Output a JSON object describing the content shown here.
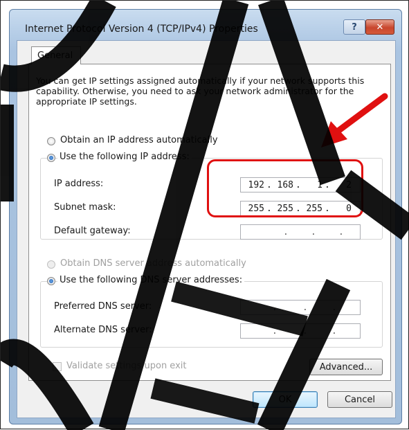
{
  "window": {
    "title": "Internet Protocol Version 4 (TCP/IPv4) Properties",
    "help_icon": "question-mark-icon",
    "help_glyph": "?",
    "close_icon": "close-icon",
    "close_glyph": "✕"
  },
  "tabs": [
    {
      "label": "General",
      "selected": true
    }
  ],
  "general": {
    "description": "You can get IP settings assigned automatically if your network supports this capability. Otherwise, you need to ask your network administrator for the appropriate IP settings.",
    "ip_mode": {
      "auto_label": "Obtain an IP address automatically",
      "auto_selected": false,
      "manual_label": "Use the following IP address:",
      "manual_selected": true
    },
    "ip_address": {
      "label": "IP address:",
      "octets": [
        "192",
        "168",
        "1",
        "2"
      ]
    },
    "subnet_mask": {
      "label": "Subnet mask:",
      "octets": [
        "255",
        "255",
        "255",
        "0"
      ]
    },
    "default_gateway": {
      "label": "Default gateway:",
      "octets": [
        "",
        "",
        "",
        ""
      ]
    },
    "dns_mode": {
      "auto_label": "Obtain DNS server address automatically",
      "auto_selected": false,
      "auto_enabled": false,
      "manual_label": "Use the following DNS server addresses:",
      "manual_selected": true
    },
    "preferred_dns": {
      "label": "Preferred DNS server:",
      "octets": [
        "",
        "",
        "",
        ""
      ]
    },
    "alternate_dns": {
      "label": "Alternate DNS server:",
      "octets": [
        "",
        "",
        "",
        ""
      ]
    },
    "validate": {
      "label": "Validate settings upon exit",
      "checked": false,
      "enabled": false
    },
    "advanced_label": "Advanced..."
  },
  "footer": {
    "ok_label": "OK",
    "cancel_label": "Cancel"
  },
  "annotations": {
    "highlight_color": "#e01010",
    "watermark_color": "#000000"
  }
}
